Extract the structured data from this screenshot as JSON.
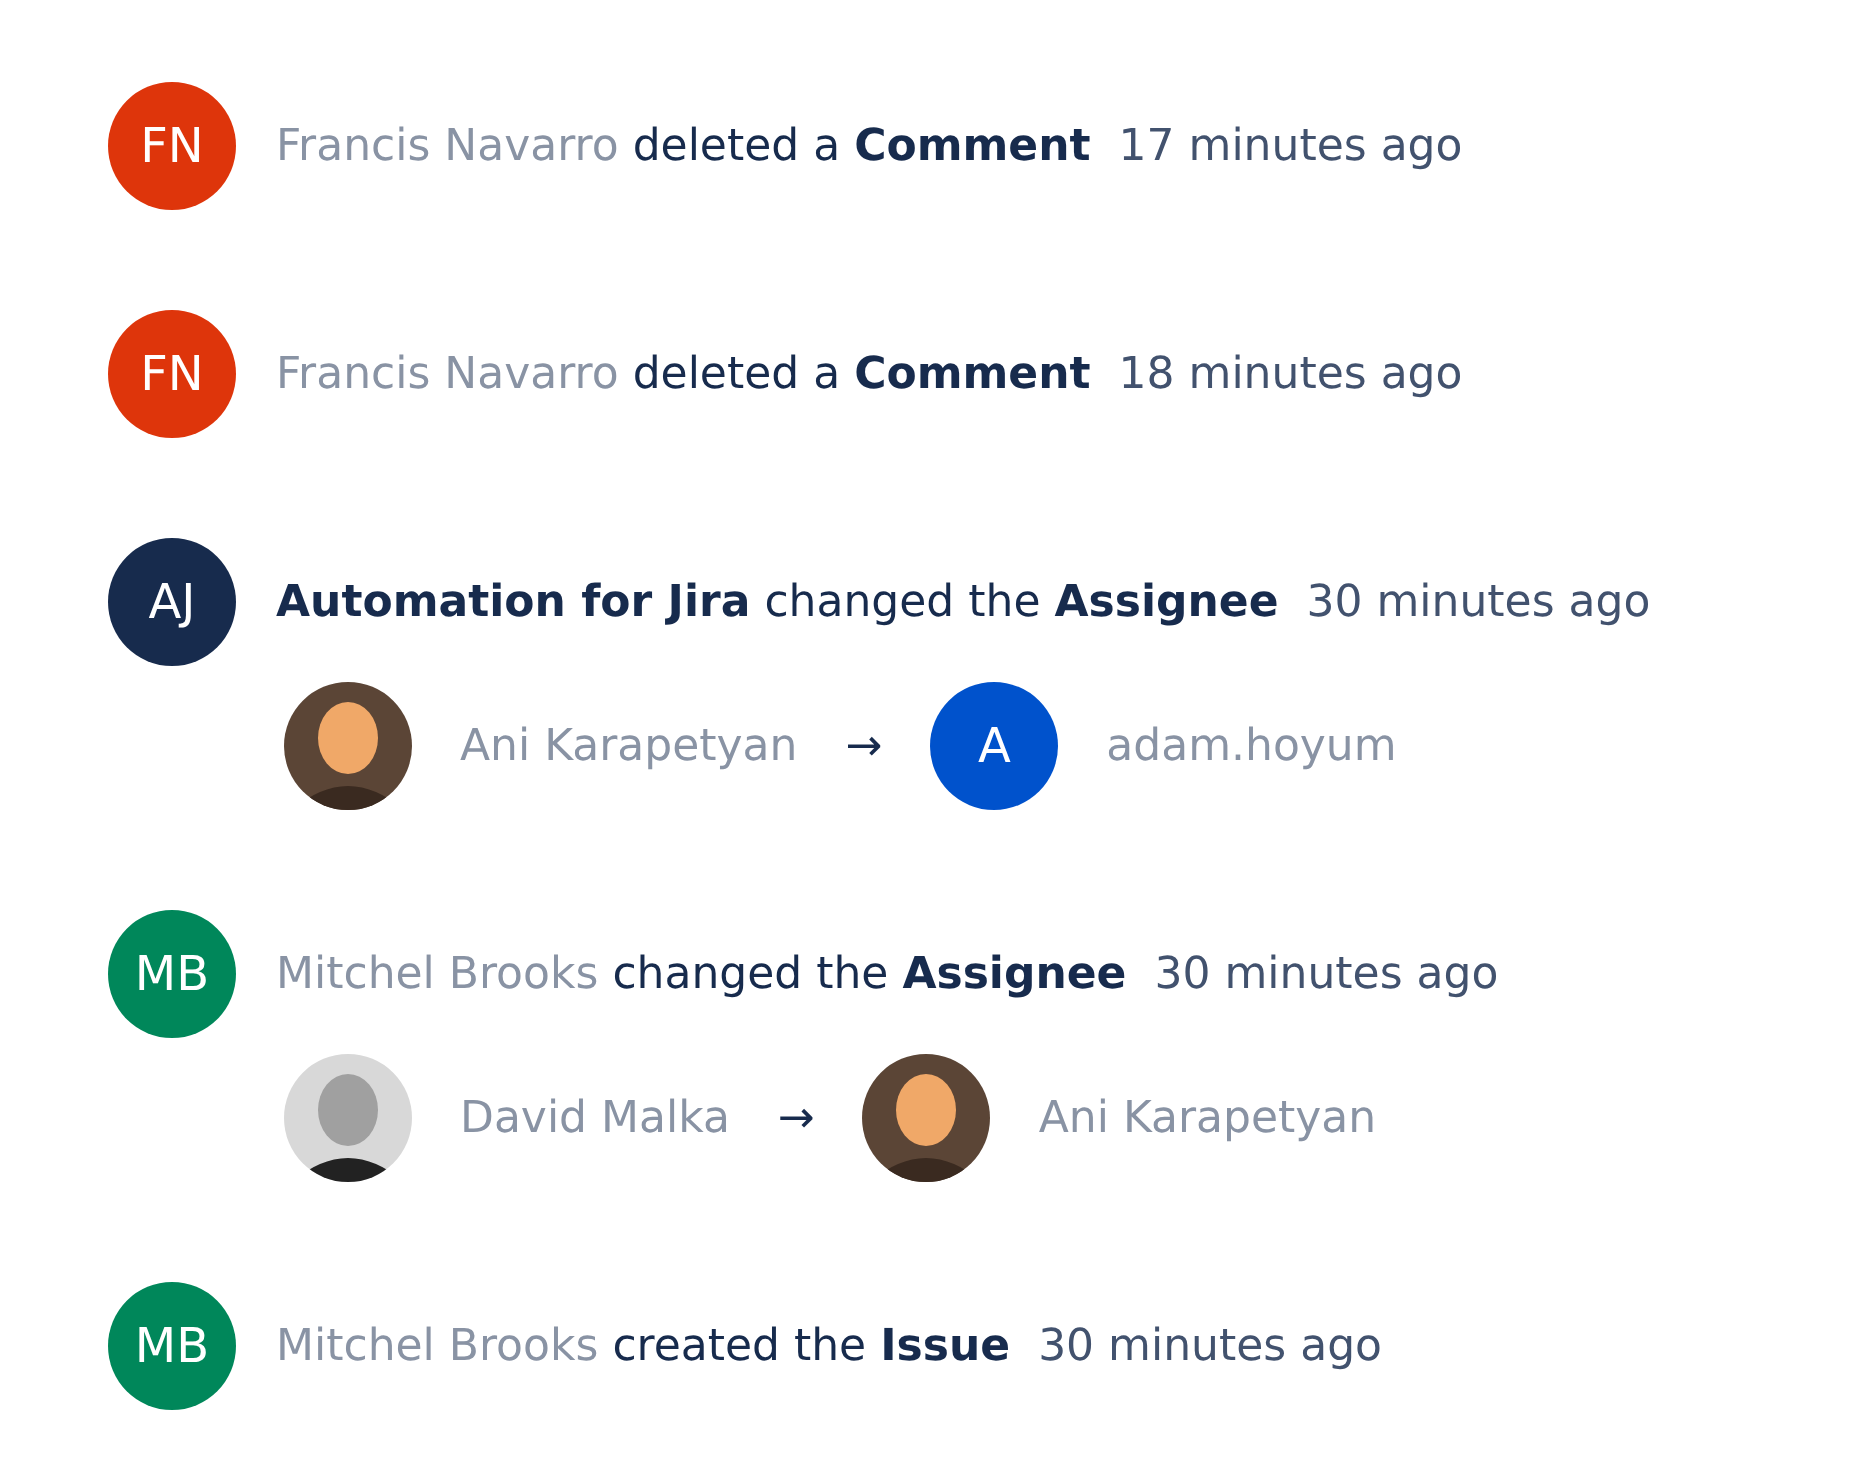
{
  "activity": [
    {
      "avatar": {
        "kind": "initials",
        "initials": "FN",
        "color": "#de350b"
      },
      "actor": "Francis Navarro",
      "faded": true,
      "action": "deleted a",
      "field": "Comment",
      "time": "17 minutes ago"
    },
    {
      "avatar": {
        "kind": "initials",
        "initials": "FN",
        "color": "#de350b"
      },
      "actor": "Francis Navarro",
      "faded": true,
      "action": "deleted a",
      "field": "Comment",
      "time": "18 minutes ago"
    },
    {
      "avatar": {
        "kind": "initials",
        "initials": "AJ",
        "color": "#172b4d"
      },
      "actor": "Automation for Jira",
      "faded": false,
      "action": "changed the",
      "field": "Assignee",
      "time": "30 minutes ago",
      "change": {
        "from": {
          "name": "Ani Karapetyan"
        },
        "arrow": "→",
        "to": {
          "avatar": {
            "kind": "initials",
            "initials": "A",
            "color": "#0052cc"
          },
          "name": "adam.hoyum"
        }
      }
    },
    {
      "avatar": {
        "kind": "initials",
        "initials": "MB",
        "color": "#00875a"
      },
      "actor": "Mitchel Brooks",
      "faded": true,
      "action": "changed the",
      "field": "Assignee",
      "time": "30 minutes ago",
      "change": {
        "from": {
          "name": "David Malka"
        },
        "arrow": "→",
        "to": {
          "name": "Ani Karapetyan"
        }
      }
    },
    {
      "avatar": {
        "kind": "initials",
        "initials": "MB",
        "color": "#00875a"
      },
      "actor": "Mitchel Brooks",
      "faded": true,
      "action": "created the",
      "field": "Issue",
      "time": "30 minutes ago"
    }
  ]
}
